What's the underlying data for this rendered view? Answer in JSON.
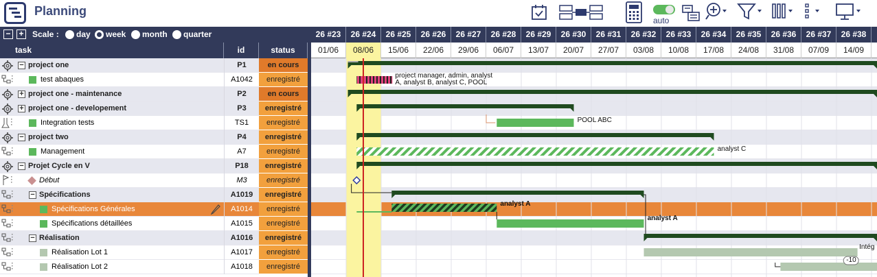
{
  "app": {
    "title": "Planning",
    "auto_label": "auto"
  },
  "toolbar": {
    "icons": [
      "calendar-check-icon",
      "dependency-icon",
      "calculator-icon",
      "auto-toggle-icon",
      "resources-icon",
      "zoom-add-icon",
      "filter-icon",
      "columns-icon",
      "more-icon",
      "monitor-icon"
    ]
  },
  "scale": {
    "label": "Scale :",
    "options": [
      "day",
      "week",
      "month",
      "quarter"
    ],
    "selected": "week"
  },
  "columns": {
    "task": "task",
    "id": "id",
    "status": "status"
  },
  "weeks": [
    "26 #23",
    "26 #24",
    "26 #25",
    "26 #26",
    "26 #27",
    "26 #28",
    "26 #29",
    "26 #30",
    "26 #31",
    "26 #32",
    "26 #33",
    "26 #34",
    "26 #35",
    "26 #36",
    "26 #37",
    "26 #38"
  ],
  "dates": [
    "01/06",
    "08/06",
    "15/06",
    "22/06",
    "29/06",
    "06/07",
    "13/07",
    "20/07",
    "27/07",
    "03/08",
    "10/08",
    "17/08",
    "24/08",
    "31/08",
    "07/09",
    "14/09"
  ],
  "today_week_index": 1,
  "rows": [
    {
      "name": "project one",
      "id": "P1",
      "status": "en cours",
      "type": "project",
      "toggle": "−",
      "icon": "gear-icon"
    },
    {
      "name": "test abaques",
      "id": "A1042",
      "status": "enregistré",
      "type": "task",
      "color": "#5cb85c",
      "icon": "tree-icon"
    },
    {
      "name": "project one - maintenance",
      "id": "P2",
      "status": "en cours",
      "type": "project",
      "toggle": "+",
      "icon": "gear-icon"
    },
    {
      "name": "project one - developement",
      "id": "P3",
      "status": "enregistré",
      "type": "project",
      "toggle": "+",
      "icon": "gear-icon"
    },
    {
      "name": "Integration tests",
      "id": "TS1",
      "status": "enregistré",
      "type": "task",
      "color": "#5cb85c",
      "icon": "flask-icon"
    },
    {
      "name": "project two",
      "id": "P4",
      "status": "enregistré",
      "type": "project",
      "toggle": "−",
      "icon": "gear-icon"
    },
    {
      "name": "Management",
      "id": "A7",
      "status": "enregistré",
      "type": "task",
      "color": "#5cb85c",
      "icon": "tree-icon"
    },
    {
      "name": "Projet Cycle en V",
      "id": "P18",
      "status": "enregistré",
      "type": "project",
      "toggle": "−",
      "icon": "gear-icon"
    },
    {
      "name": "Début",
      "id": "M3",
      "status": "enregistré",
      "type": "milestone",
      "icon": "flag-icon"
    },
    {
      "name": "Spécifications",
      "id": "A1019",
      "status": "enregistré",
      "type": "group",
      "toggle": "−",
      "icon": "tree-icon"
    },
    {
      "name": "Spécifications Générales",
      "id": "A1014",
      "status": "enregistré",
      "type": "subtask",
      "color": "#5cb85c",
      "icon": "tree-icon",
      "selected": true
    },
    {
      "name": "Spécifications détaillées",
      "id": "A1015",
      "status": "enregistré",
      "type": "subtask",
      "color": "#5cb85c",
      "icon": "tree-icon"
    },
    {
      "name": "Réalisation",
      "id": "A1016",
      "status": "enregistré",
      "type": "group",
      "toggle": "−",
      "icon": "tree-icon"
    },
    {
      "name": "Réalisation Lot 1",
      "id": "A1017",
      "status": "enregistré",
      "type": "subtask",
      "color": "#b4c8b0",
      "icon": "tree-icon"
    },
    {
      "name": "Réalisation Lot 2",
      "id": "A1018",
      "status": "enregistré",
      "type": "subtask",
      "color": "#b4c8b0",
      "icon": "tree-icon"
    }
  ],
  "bar_labels": {
    "test_abaques_1": "project manager, admin, analyst",
    "test_abaques_2": "A, analyst B, analyst C, POOL",
    "integration": "POOL ABC",
    "management": "analyst C",
    "spec_gen": "analyst A",
    "spec_det": "analyst A",
    "lot1": "Intég",
    "lot2_lag": "-10"
  },
  "colors": {
    "header": "#323a5a",
    "group_bar": "#1f4a1f",
    "task_bar": "#5cb85c",
    "pending_bar": "#b4c8b0",
    "selected_row": "#e8873a",
    "status": "#f2a03d",
    "today_line": "#cc2222",
    "today_column": "#fbf4a0"
  }
}
